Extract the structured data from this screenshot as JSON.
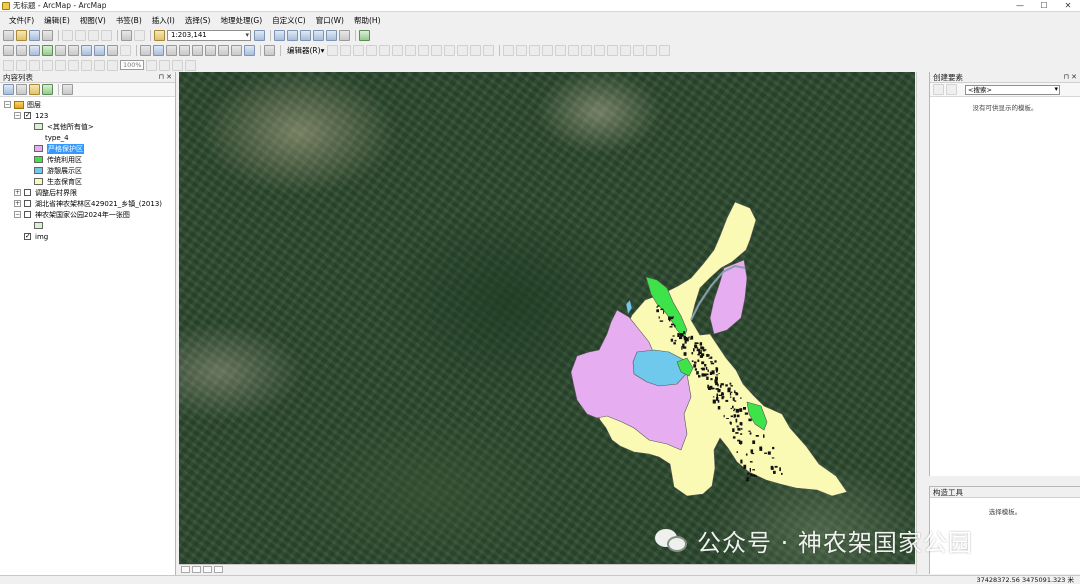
{
  "window": {
    "title": "无标题 - ArcMap - ArcMap",
    "controls": [
      "—",
      "☐",
      "✕"
    ]
  },
  "menu": [
    "文件(F)",
    "编辑(E)",
    "视图(V)",
    "书签(B)",
    "插入(I)",
    "选择(S)",
    "地理处理(G)",
    "自定义(C)",
    "窗口(W)",
    "帮助(H)"
  ],
  "toolbar": {
    "scale": "1:203,141",
    "editor_label": "编辑器(R)▾",
    "zoom": "100%"
  },
  "toc": {
    "title": "内容列表",
    "pin": "⊓ ✕",
    "layers_label": "图层",
    "group_123": "123",
    "other_values": "<其他所有值>",
    "type_field": "type_4",
    "legend": [
      {
        "label": "严格保护区",
        "color": "#e6aef0"
      },
      {
        "label": "传统利用区",
        "color": "#3ee34a"
      },
      {
        "label": "游憩展示区",
        "color": "#6ec9ec"
      },
      {
        "label": "生态保育区",
        "color": "#fafab4"
      }
    ],
    "layers": [
      {
        "label": "调整后村界限"
      },
      {
        "label": "湖北省神农架林区429021_乡镇_(2013)"
      },
      {
        "label": "神农架国家公园2024年一张图"
      }
    ],
    "img_layer": "img"
  },
  "create_features": {
    "title": "创建要素",
    "pin": "⊓ ✕",
    "search_placeholder": "<搜索>",
    "empty_message": "没有可供显示的模板。"
  },
  "construct_tools": {
    "title": "构造工具",
    "empty_message": "选择模板。"
  },
  "status": {
    "coordinates": "37428372.56  3475091.323 米"
  },
  "watermark": {
    "text": "公众号 · 神农架国家公园"
  },
  "colors": {
    "strict_protection": "#e6aef0",
    "traditional_use": "#3ee34a",
    "recreation": "#6ec9ec",
    "ecological_conservation": "#fafab4",
    "selection_highlight": "#3399ff"
  }
}
